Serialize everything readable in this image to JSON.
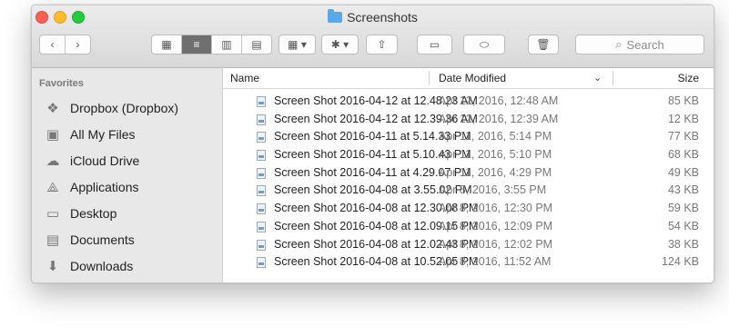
{
  "window": {
    "title": "Screenshots"
  },
  "toolbar": {
    "back_label": "‹",
    "forward_label": "›",
    "view_icon_label": "▦",
    "view_list_label": "≡",
    "view_columns_label": "▥",
    "view_coverflow_label": "▤",
    "arrange_label": "▦ ▾",
    "action_label": "✱ ▾",
    "share_label": "⇧",
    "newfolder_label": "▭",
    "tags_label": "⬭",
    "trash_label": "🗑",
    "search_placeholder": "Search"
  },
  "sidebar": {
    "heading": "Favorites",
    "items": [
      {
        "label": "Dropbox (Dropbox)",
        "icon": "dropbox-icon"
      },
      {
        "label": "All My Files",
        "icon": "all-files-icon"
      },
      {
        "label": "iCloud Drive",
        "icon": "cloud-icon"
      },
      {
        "label": "Applications",
        "icon": "applications-icon"
      },
      {
        "label": "Desktop",
        "icon": "desktop-icon"
      },
      {
        "label": "Documents",
        "icon": "documents-icon"
      },
      {
        "label": "Downloads",
        "icon": "downloads-icon"
      }
    ]
  },
  "columns": {
    "name": "Name",
    "date": "Date Modified",
    "size": "Size"
  },
  "files": [
    {
      "name": "Screen Shot 2016-04-12 at 12.48.23 AM",
      "date": "Apr 12, 2016, 12:48 AM",
      "size": "85 KB"
    },
    {
      "name": "Screen Shot 2016-04-12 at 12.39.36 AM",
      "date": "Apr 12, 2016, 12:39 AM",
      "size": "12 KB"
    },
    {
      "name": "Screen Shot 2016-04-11 at 5.14.33 PM",
      "date": "Apr 11, 2016, 5:14 PM",
      "size": "77 KB"
    },
    {
      "name": "Screen Shot 2016-04-11 at 5.10.43 PM",
      "date": "Apr 11, 2016, 5:10 PM",
      "size": "68 KB"
    },
    {
      "name": "Screen Shot 2016-04-11 at 4.29.07 PM",
      "date": "Apr 11, 2016, 4:29 PM",
      "size": "49 KB"
    },
    {
      "name": "Screen Shot 2016-04-08 at 3.55.02 PM",
      "date": "Apr 8, 2016, 3:55 PM",
      "size": "43 KB"
    },
    {
      "name": "Screen Shot 2016-04-08 at 12.30.08 PM",
      "date": "Apr 8, 2016, 12:30 PM",
      "size": "59 KB"
    },
    {
      "name": "Screen Shot 2016-04-08 at 12.09.15 PM",
      "date": "Apr 8, 2016, 12:09 PM",
      "size": "54 KB"
    },
    {
      "name": "Screen Shot 2016-04-08 at 12.02.43 PM",
      "date": "Apr 8, 2016, 12:02 PM",
      "size": "38 KB"
    },
    {
      "name": "Screen Shot 2016-04-08 at 10.52.05 PM",
      "date": "Apr 8, 2016, 11:52 AM",
      "size": "124 KB"
    }
  ]
}
